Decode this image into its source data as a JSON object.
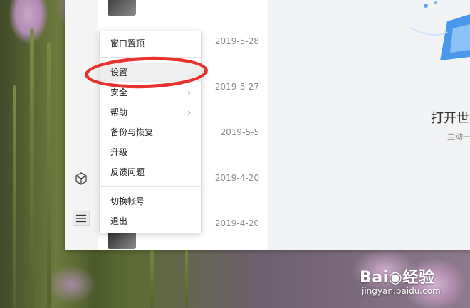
{
  "menu": {
    "items": [
      {
        "label": "窗口置顶",
        "has_submenu": false
      },
      {
        "label": "设置",
        "has_submenu": false,
        "highlighted": true
      },
      {
        "label": "安全",
        "has_submenu": true
      },
      {
        "label": "帮助",
        "has_submenu": true
      },
      {
        "label": "备份与恢复",
        "has_submenu": false
      },
      {
        "label": "升级",
        "has_submenu": false
      },
      {
        "label": "反馈问题",
        "has_submenu": false
      },
      {
        "label": "切换帐号",
        "has_submenu": false
      },
      {
        "label": "退出",
        "has_submenu": false
      }
    ]
  },
  "list": {
    "dates": [
      "2019-5-28",
      "2019-5-27",
      "2019-5-5",
      "2019-4-20",
      "2019-4-20"
    ]
  },
  "right_panel": {
    "title": "打开世",
    "subtitle": "主动一"
  },
  "watermark": {
    "brand": "Bai◉经验",
    "url": "jingyan.baidu.com"
  },
  "icons": {
    "rail_top": "cube-icon",
    "rail_bottom": "menu-icon",
    "submenu": "chevron-right-icon"
  },
  "colors": {
    "annotation": "#e8322d",
    "menu_highlight": "#eeeeee"
  }
}
